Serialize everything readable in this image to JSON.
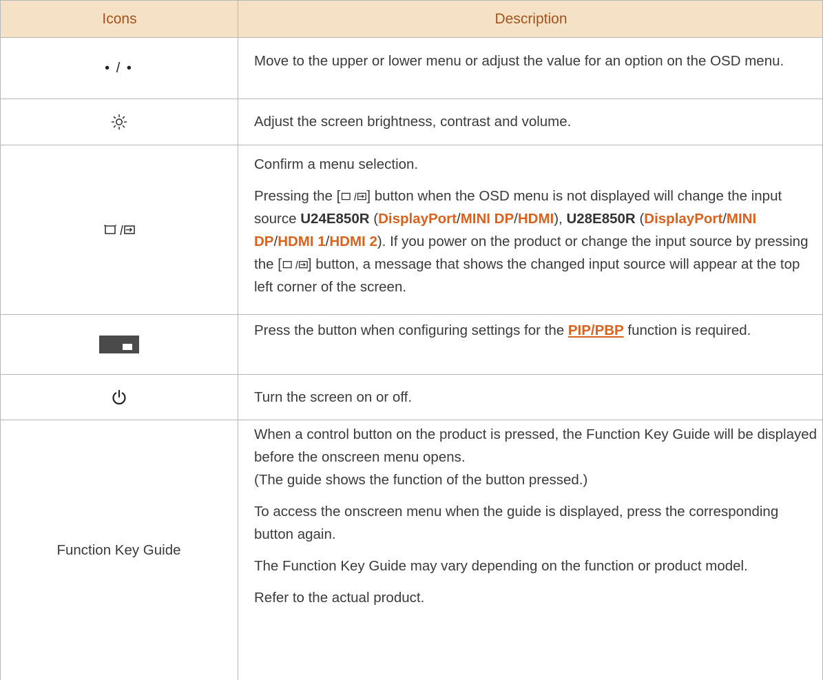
{
  "table": {
    "headers": {
      "icons": "Icons",
      "description": "Description"
    },
    "rows": {
      "updown": {
        "icon_text": "• / •",
        "desc": "Move to the upper or lower menu or adjust the value for an option on the OSD menu."
      },
      "brightness": {
        "icon": "brightness-sun-icon",
        "desc": "Adjust the screen brightness, contrast and volume."
      },
      "source": {
        "icon": "menu-source-icon",
        "p1": "Confirm a menu selection.",
        "p2": {
          "a": "Pressing the [",
          "b": "] button when the OSD menu is not displayed will change the input source ",
          "model1": "U24E850R",
          "open": " (",
          "displayport": "DisplayPort",
          "slash": "/",
          "minidp": "MINI DP",
          "hdmi": "HDMI",
          "close1": "), ",
          "model2": "U28E850R",
          "hdmi1": "HDMI 1",
          "hdmi2": "HDMI 2",
          "close2": "). If you power on the product or change the input source by pressing the [",
          "end": "] button, a message that shows the changed input source will appear at the top left corner of the screen."
        }
      },
      "pip": {
        "icon": "pip-pbp-icon",
        "a": "Press the button when configuring settings for the ",
        "link": "PIP/PBP",
        "b": " function is required."
      },
      "power": {
        "icon": "power-icon",
        "desc": "Turn the screen on or off."
      },
      "guide": {
        "label": "Function Key Guide",
        "p1a": "When a control button on the product is pressed, the Function Key Guide will be displayed before the onscreen menu opens.",
        "p1b": "(The guide shows the function of the button pressed.)",
        "p2": "To access the onscreen menu when the guide is displayed, press the corresponding button again.",
        "p3": "The Function Key Guide may vary depending on the function or product model.",
        "p4": "Refer to the actual product."
      }
    }
  },
  "colors": {
    "header_bg": "#f4e1c6",
    "header_text": "#a4531b",
    "accent": "#d9621f",
    "border": "#b5b5b5"
  }
}
